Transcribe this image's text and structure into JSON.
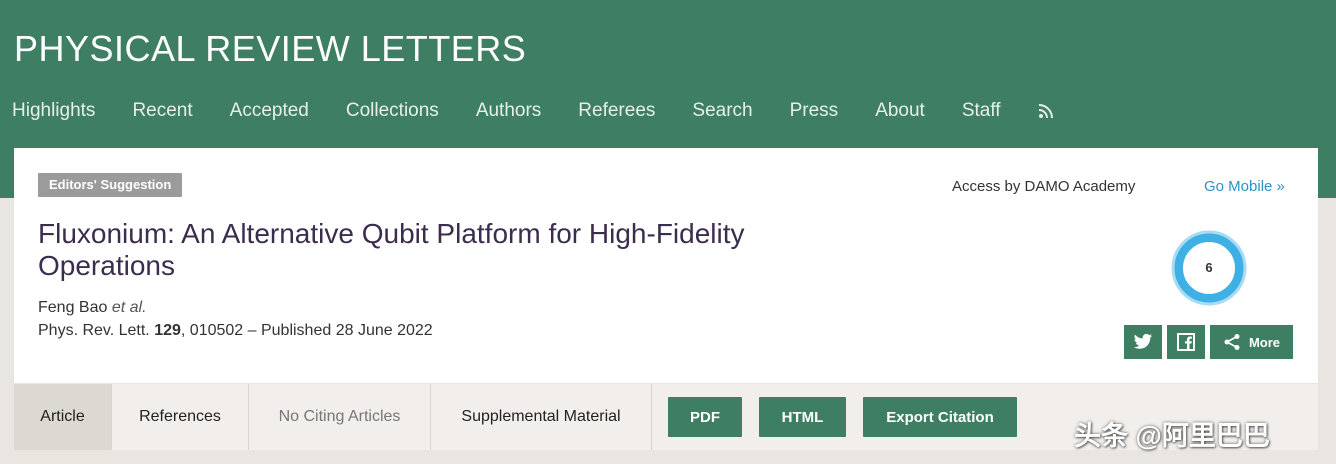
{
  "journal": {
    "title": "PHYSICAL REVIEW LETTERS"
  },
  "nav": {
    "items": [
      "Highlights",
      "Recent",
      "Accepted",
      "Collections",
      "Authors",
      "Referees",
      "Search",
      "Press",
      "About",
      "Staff"
    ],
    "rss_icon": "rss-icon"
  },
  "article": {
    "badge": "Editors' Suggestion",
    "access": "Access by DAMO Academy",
    "go_mobile": "Go Mobile »",
    "title": "Fluxonium: An Alternative Qubit Platform for High-Fidelity Operations",
    "author": "Feng Bao",
    "author_etal": "et al.",
    "journal_abbrev": "Phys. Rev. Lett.",
    "volume": "129",
    "citation_rest": ", 010502 – Published 28 June 2022",
    "altmetric_score": "6"
  },
  "share": {
    "twitter_icon": "twitter-icon",
    "facebook_icon": "facebook-icon",
    "more_label": "More"
  },
  "tabs": {
    "article": "Article",
    "references": "References",
    "citing": "No Citing Articles",
    "supplemental": "Supplemental Material"
  },
  "buttons": {
    "pdf": "PDF",
    "html": "HTML",
    "export": "Export Citation"
  },
  "watermark": "头条 @阿里巴巴",
  "colors": {
    "brand_green": "#3e7f63",
    "link_blue": "#2a93c9",
    "title_purple": "#3c2d4f"
  }
}
